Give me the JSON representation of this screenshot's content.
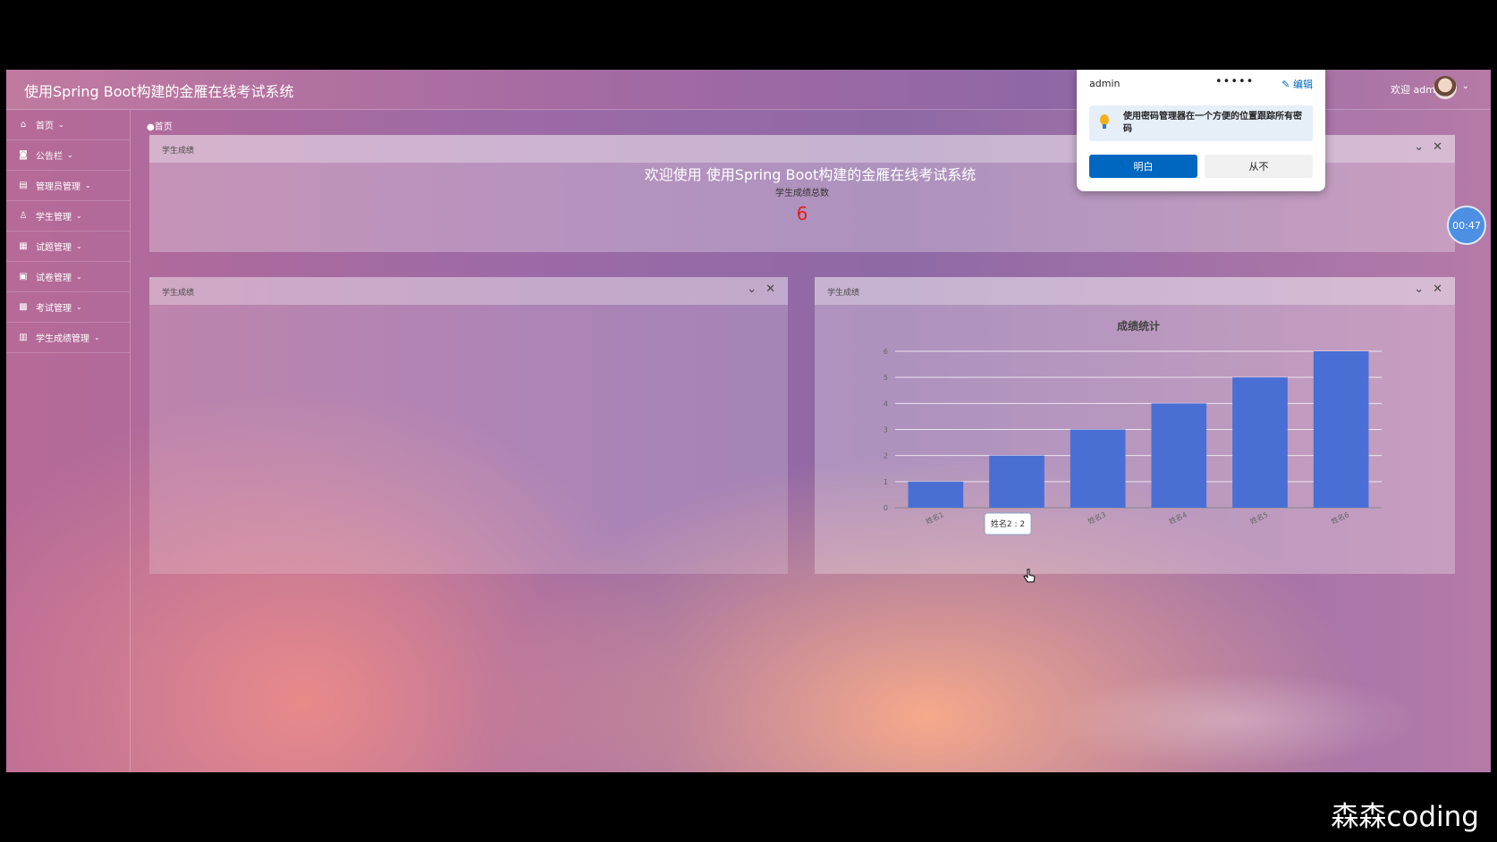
{
  "app": {
    "title": "使用Spring Boot构建的金雁在线考试系统",
    "welcome_user": "欢迎 admin",
    "user_chevron": "⌄"
  },
  "sidebar": {
    "items": [
      {
        "label": "首页",
        "icon": "home-icon"
      },
      {
        "label": "公告栏",
        "icon": "notice-icon"
      },
      {
        "label": "管理员管理",
        "icon": "admin-icon"
      },
      {
        "label": "学生管理",
        "icon": "user-icon"
      },
      {
        "label": "试题管理",
        "icon": "grid-icon"
      },
      {
        "label": "试卷管理",
        "icon": "paper-icon"
      },
      {
        "label": "考试管理",
        "icon": "exam-icon"
      },
      {
        "label": "学生成绩管理",
        "icon": "score-icon"
      }
    ]
  },
  "breadcrumb": "●首页",
  "page_heading": "欢迎使用 使用Spring Boot构建的金雁在线考试系统",
  "panels": {
    "total": {
      "title": "学生成绩",
      "stat_label": "学生成绩总数",
      "stat_value": "6"
    },
    "left": {
      "title": "学生成绩"
    },
    "right": {
      "title": "学生成绩"
    }
  },
  "chart_data": {
    "type": "bar",
    "title": "成绩统计",
    "categories": [
      "姓名1",
      "姓名2",
      "姓名3",
      "姓名4",
      "姓名5",
      "姓名6"
    ],
    "values": [
      1,
      2,
      3,
      4,
      5,
      6
    ],
    "ylim": [
      0,
      6
    ],
    "yticks": [
      0,
      1,
      2,
      3,
      4,
      5,
      6
    ],
    "grid": true,
    "bar_color": "#4a6fd4",
    "tooltip": {
      "category_index": 1,
      "text": "姓名2 : 2"
    }
  },
  "password_popup": {
    "username": "admin",
    "masked_password": "•••••",
    "edit_label": "编辑",
    "info_text": "使用密码管理器在一个方便的位置跟踪所有密码",
    "ok_label": "明白",
    "never_label": "从不"
  },
  "timer": "00:47",
  "watermark": "森森coding"
}
